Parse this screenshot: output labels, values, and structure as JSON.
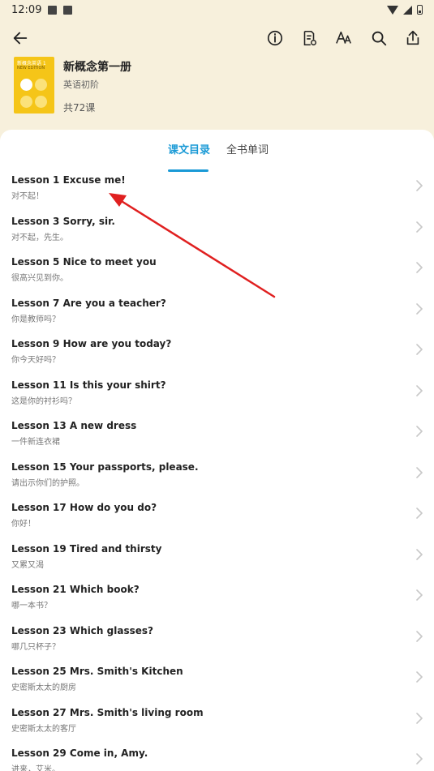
{
  "status": {
    "time": "12:09"
  },
  "book": {
    "title": "新概念第一册",
    "level": "英语初阶",
    "count": "共72课",
    "cover_title": "新概念英语 1",
    "cover_subtitle": "NEW EDITION"
  },
  "tabs": [
    {
      "label": "课文目录",
      "active": true
    },
    {
      "label": "全书单词",
      "active": false
    }
  ],
  "lessons": [
    {
      "title": "Lesson 1 Excuse me!",
      "subtitle": "对不起！"
    },
    {
      "title": "Lesson 3 Sorry, sir.",
      "subtitle": "对不起，先生。"
    },
    {
      "title": "Lesson 5 Nice to meet you",
      "subtitle": "很高兴见到你。"
    },
    {
      "title": "Lesson 7 Are you a teacher?",
      "subtitle": "你是教师吗？"
    },
    {
      "title": "Lesson 9 How are you today?",
      "subtitle": "你今天好吗？"
    },
    {
      "title": "Lesson 11 Is this your shirt?",
      "subtitle": "这是你的衬衫吗？"
    },
    {
      "title": "Lesson 13 A new dress",
      "subtitle": "一件新连衣裙"
    },
    {
      "title": "Lesson 15 Your passports, please.",
      "subtitle": "请出示你们的护照。"
    },
    {
      "title": "Lesson 17 How do you do?",
      "subtitle": "你好！"
    },
    {
      "title": "Lesson 19 Tired and thirsty",
      "subtitle": "又累又渴"
    },
    {
      "title": "Lesson 21 Which book?",
      "subtitle": "哪一本书？"
    },
    {
      "title": "Lesson 23 Which glasses?",
      "subtitle": "哪几只杯子？"
    },
    {
      "title": "Lesson 25 Mrs. Smith's Kitchen",
      "subtitle": "史密斯太太的厨房"
    },
    {
      "title": "Lesson 27 Mrs. Smith's living room",
      "subtitle": "史密斯太太的客厅"
    },
    {
      "title": "Lesson 29 Come in, Amy.",
      "subtitle": "进来，艾米。"
    }
  ],
  "colors": {
    "accent": "#1a9ad6",
    "background": "#f7f0dc",
    "annotation_arrow": "#e02020"
  }
}
